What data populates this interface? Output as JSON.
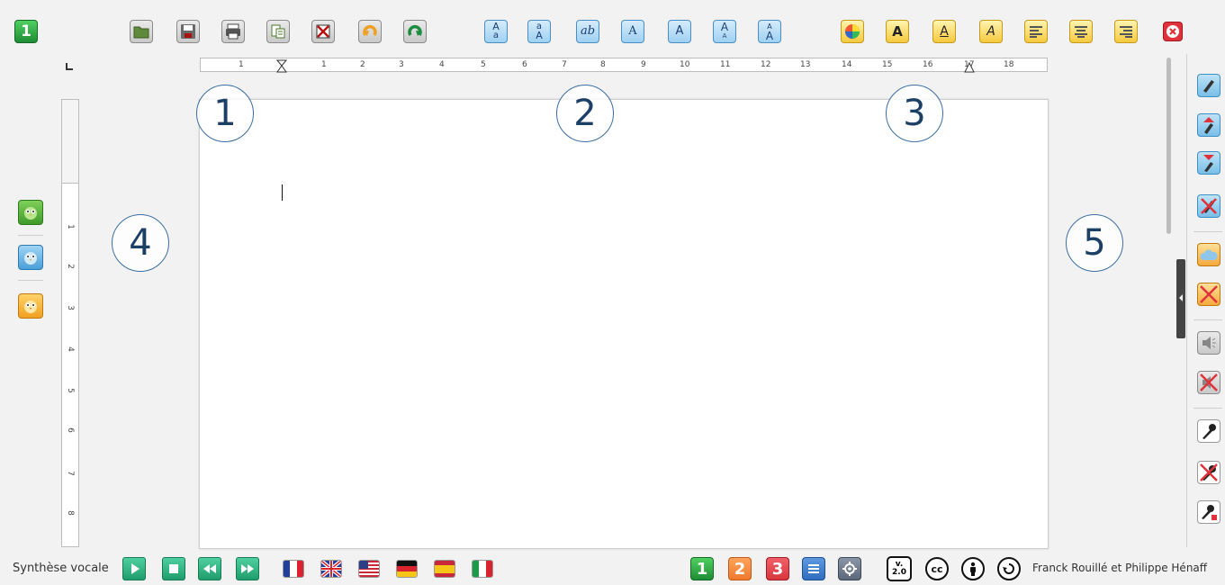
{
  "callouts": [
    "1",
    "2",
    "3",
    "4",
    "5"
  ],
  "level_badge_top": "1",
  "toolbar": {
    "file_icons": [
      "open-folder-icon",
      "save-icon",
      "print-icon",
      "properties-icon",
      "close-document-icon",
      "undo-icon",
      "redo-icon"
    ],
    "case_buttons": [
      {
        "name": "uppercase-to-lowercase",
        "top": "A",
        "bottom": "a"
      },
      {
        "name": "lowercase-to-uppercase",
        "top": "a",
        "bottom": "A"
      },
      {
        "name": "lowercase-cursive",
        "top": "",
        "bottom": "ab"
      },
      {
        "name": "serif-switch",
        "top": "",
        "bottom": "A"
      },
      {
        "name": "sans-switch",
        "top": "",
        "bottom": "A"
      },
      {
        "name": "shrink-font",
        "top": "A",
        "bottom": "A"
      },
      {
        "name": "grow-font",
        "top": "A",
        "bottom": "A"
      }
    ],
    "style_buttons": [
      {
        "name": "bold",
        "label": "A"
      },
      {
        "name": "underline",
        "label": "A"
      },
      {
        "name": "italic",
        "label": "A"
      }
    ]
  },
  "ruler": {
    "h_labels": [
      "1",
      "1",
      "2",
      "3",
      "4",
      "5",
      "6",
      "7",
      "8",
      "9",
      "10",
      "11",
      "12",
      "13",
      "14",
      "15",
      "16",
      "17",
      "18"
    ],
    "v_labels": [
      "1",
      "1",
      "2",
      "3",
      "4",
      "5",
      "6",
      "7",
      "8"
    ]
  },
  "status": {
    "label": "Synthèse vocale",
    "levels": [
      "1",
      "2",
      "3"
    ],
    "version": "v. 2.0",
    "credits": "Franck Rouillé et Philippe Hénaff"
  },
  "colors": {
    "green": "#2aa44a",
    "orange": "#f07a2e",
    "red": "#d9363e",
    "blue": "#2f6fbf",
    "accent_yellow": "#f6c93e"
  }
}
